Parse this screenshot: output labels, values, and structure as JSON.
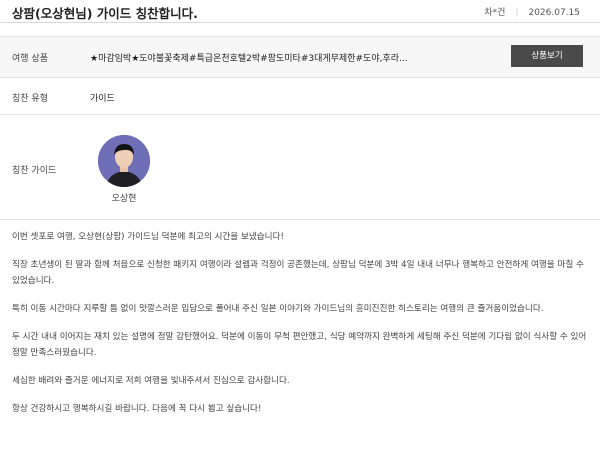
{
  "header": {
    "title": "상팜(오상현님) 가이드 칭찬합니다.",
    "round": "차*건",
    "date": "2026.07.15"
  },
  "product": {
    "label": "여행 상품",
    "value": "★마감임박★도야불꽃축제#특급온천호텔2박#팜도미타#3대게무제한#도야,후라...",
    "button_label": "상품보기"
  },
  "praise_type": {
    "label": "칭찬 유형",
    "value": "가이드"
  },
  "guide": {
    "label": "칭찬 가이드",
    "name": "오상현"
  },
  "body": {
    "paragraphs": [
      "이번 셋포로 여행, 오상현(상팜) 가이드님 덕분에 최고의 시간을 보냈습니다!",
      "직장 초년생이 된 딸과 함께 처음으로 신청한 패키지 여행이라 설렘과 걱정이 공존했는데, 상팜님 덕분에 3박 4일 내내 너무나 행복하고 안전하게 여행을 마칠 수 있었습니다.",
      "특히 이동 시간마다 지루할 틈 없이 맛깔스러운 입담으로 풀어내 주신 일본 이야기와 가이드님의 흥미진진한 히스토리는 여행의 큰 즐거움이었습니다.",
      "두 시간 내내 이어지는 재치 있는 설명에 정말 감탄했어요. 덕분에 이동이 무척 편안했고, 식당 예약까지 완벽하게 세팅해 주신 덕분에 기다림 없이 식사할 수 있어 정말 만족스러웠습니다.",
      "세심한 배려와 즐거운 에너지로 저희 여행을 빛내주셔서 진심으로 감사합니다.",
      "항상 건강하시고 행복하시길 바랍니다. 다음에 꼭 다시 뵙고 싶습니다!"
    ]
  },
  "colors": {
    "button_bg": "#4a4a4a",
    "row_bg": "#f7f7f7",
    "avatar_bg": "#6f6fb8"
  }
}
